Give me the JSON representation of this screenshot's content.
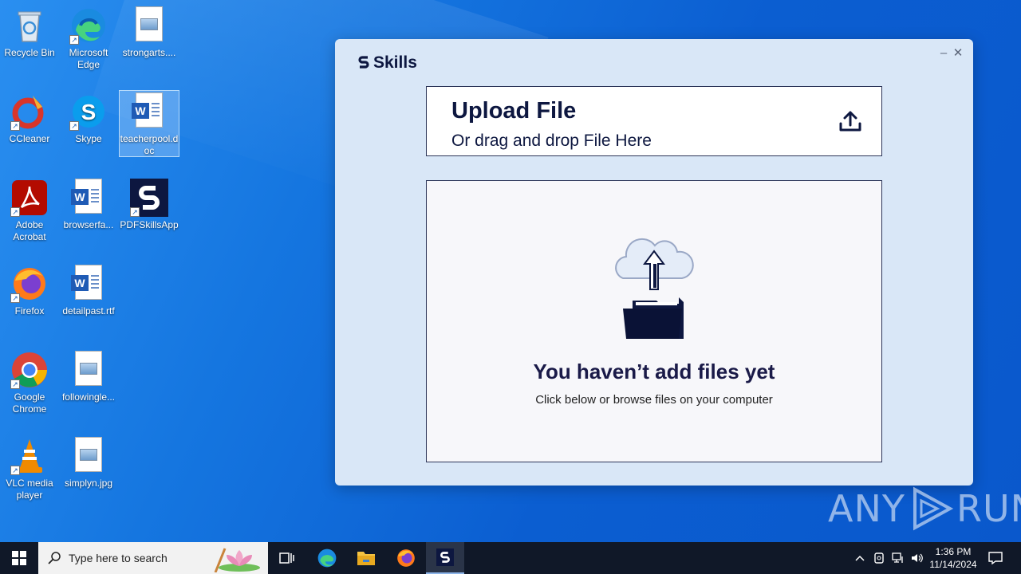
{
  "desktop_icons": [
    {
      "label": "Recycle Bin"
    },
    {
      "label": "Microsoft Edge"
    },
    {
      "label": "strongarts...."
    },
    {
      "label": "CCleaner"
    },
    {
      "label": "Skype"
    },
    {
      "label": "teacherpool.doc"
    },
    {
      "label": "Adobe Acrobat"
    },
    {
      "label": "browserfa..."
    },
    {
      "label": "PDFSkillsApp"
    },
    {
      "label": "Firefox"
    },
    {
      "label": "detailpast.rtf"
    },
    {
      "label": "Google Chrome"
    },
    {
      "label": "followingle..."
    },
    {
      "label": "VLC media player"
    },
    {
      "label": "simplyn.jpg"
    }
  ],
  "app": {
    "brand": "Skills",
    "minimize": "–",
    "close": "✕",
    "upload_title": "Upload File",
    "upload_subtitle": "Or drag and drop File Here",
    "empty_title": "You haven’t add files yet",
    "empty_subtitle": "Click below or browse files on your computer",
    "accent_color": "#0d1740"
  },
  "watermark": {
    "left": "ANY",
    "right": "RUN"
  },
  "taskbar": {
    "search_placeholder": "Type here to search",
    "time": "1:36 PM",
    "date": "11/14/2024"
  }
}
